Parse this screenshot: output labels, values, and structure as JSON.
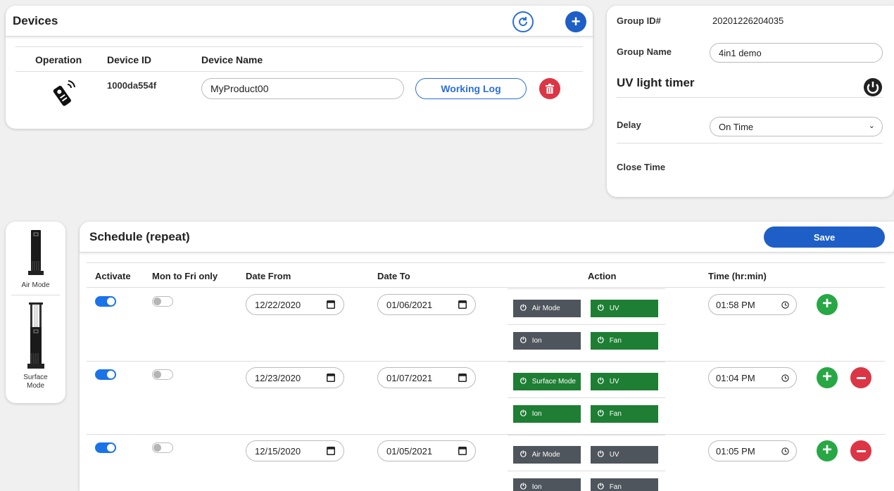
{
  "devices": {
    "title": "Devices",
    "columns": {
      "operation": "Operation",
      "device_id": "Device ID",
      "device_name": "Device Name"
    },
    "row": {
      "device_id": "1000da554f",
      "device_name": "MyProduct00",
      "working_log_label": "Working Log"
    }
  },
  "group": {
    "group_id_label": "Group ID#",
    "group_id_value": "20201226204035",
    "group_name_label": "Group Name",
    "group_name_value": "4in1 demo",
    "uv_title": "UV light timer",
    "delay_label": "Delay",
    "delay_value": "On Time",
    "close_time_label": "Close Time"
  },
  "modes": [
    {
      "label": "Air Mode"
    },
    {
      "label": "Surface Mode"
    }
  ],
  "schedule": {
    "title": "Schedule (repeat)",
    "save_label": "Save",
    "columns": {
      "activate": "Activate",
      "mon_fri": "Mon to Fri only",
      "date_from": "Date From",
      "date_to": "Date To",
      "action": "Action",
      "time": "Time (hr:min)"
    },
    "rows": [
      {
        "activate": true,
        "mon_fri": false,
        "date_from": "12/22/2020",
        "date_to": "01/06/2021",
        "mode_label": "Air Mode",
        "mode_active": false,
        "uv": "UV",
        "uv_active": true,
        "ion": "Ion",
        "ion_active": false,
        "fan": "Fan",
        "fan_active": true,
        "time": "01:58 PM",
        "removable": false
      },
      {
        "activate": true,
        "mon_fri": false,
        "date_from": "12/23/2020",
        "date_to": "01/07/2021",
        "mode_label": "Surface Mode",
        "mode_active": true,
        "uv": "UV",
        "uv_active": true,
        "ion": "Ion",
        "ion_active": true,
        "fan": "Fan",
        "fan_active": true,
        "time": "01:04 PM",
        "removable": true
      },
      {
        "activate": true,
        "mon_fri": false,
        "date_from": "12/15/2020",
        "date_to": "01/05/2021",
        "mode_label": "Air Mode",
        "mode_active": false,
        "uv": "UV",
        "uv_active": false,
        "ion": "Ion",
        "ion_active": false,
        "fan": "Fan",
        "fan_active": false,
        "time": "01:05 PM",
        "removable": true
      }
    ]
  },
  "colors": {
    "primary": "#1e5fc7",
    "active_green": "#1e7e34",
    "inactive_dark": "#4f555c",
    "danger": "#dc3545",
    "add_green": "#28a745"
  }
}
